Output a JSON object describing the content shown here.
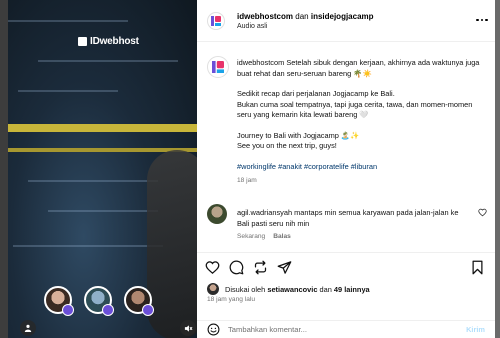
{
  "post": {
    "header": {
      "user1": "idwebhostcom",
      "joiner": "dan",
      "user2": "insidejogjacamp",
      "audio": "Audio asli"
    },
    "caption": {
      "username": "idwebhostcom",
      "para1": "Setelah sibuk dengan kerjaan, akhirnya ada waktunya juga buat rehat dan seru-seruan bareng 🌴☀️",
      "para2a": "Sedikit recap dari perjalanan Jogjacamp ke Bali.",
      "para2b": "Bukan cuma soal tempatnya, tapi juga cerita, tawa, dan momen-momen seru yang kemarin kita lewati bareng 🤍",
      "para3a": "Journey to Bali with Jogjacamp 🏝️✨",
      "para3b": "See you on the next trip, guys!",
      "hashtags": "#workinglife #anakit #corporatelife #liburan",
      "time": "18 jam"
    },
    "comment": {
      "username": "agil.wadriansyah",
      "text": "mantaps min semua karyawan pada jalan-jalan ke Bali pasti seru nih min",
      "when": "Sekarang",
      "reply": "Balas"
    },
    "likes": {
      "prefix": "Disukai oleh",
      "name": "setiawancovic",
      "middle": "dan",
      "others": "49 lainnya"
    },
    "posted": "18 jam yang lalu",
    "input": {
      "placeholder": "Tambahkan komentar...",
      "post_label": "Kirim"
    }
  },
  "media": {
    "watermark": "IDwebhost"
  },
  "colors": {
    "link": "#00376b",
    "post_disabled": "#b2dffc",
    "muted": "#737373",
    "brand_purple": "#6b4fd8"
  }
}
